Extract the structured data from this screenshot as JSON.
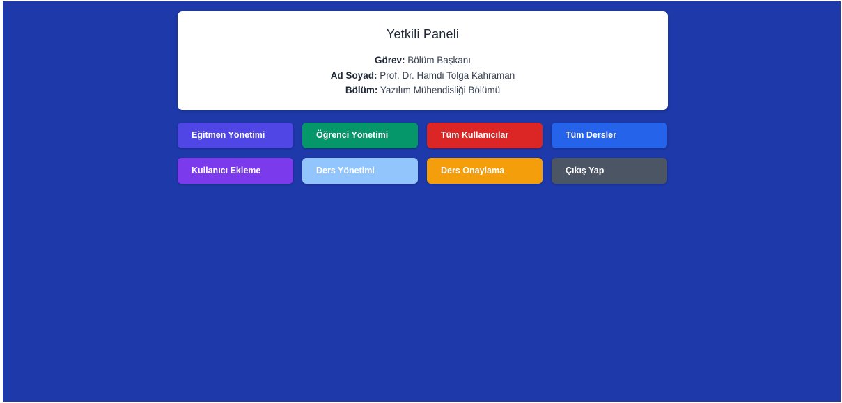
{
  "panel": {
    "title": "Yetkili Paneli",
    "gorev_label": "Görev:",
    "gorev_value": "Bölüm Başkanı",
    "ad_label": "Ad Soyad:",
    "ad_value": "Prof. Dr. Hamdi Tolga Kahraman",
    "bolum_label": "Bölüm:",
    "bolum_value": "Yazılım Mühendisliği Bölümü"
  },
  "buttons": [
    {
      "label": "Eğitmen Yönetimi",
      "color": "#4f46e5"
    },
    {
      "label": "Öğrenci Yönetimi",
      "color": "#059669"
    },
    {
      "label": "Tüm Kullanıcılar",
      "color": "#dc2626"
    },
    {
      "label": "Tüm Dersler",
      "color": "#2563eb"
    },
    {
      "label": "Kullanıcı Ekleme",
      "color": "#7c3aed"
    },
    {
      "label": "Ders Yönetimi",
      "color": "#93c5fd"
    },
    {
      "label": "Ders Onaylama",
      "color": "#f59e0b"
    },
    {
      "label": "Çıkış Yap",
      "color": "#4b5563"
    }
  ],
  "colors": {
    "background": "#1e3aaa",
    "panel": "#ffffff"
  }
}
